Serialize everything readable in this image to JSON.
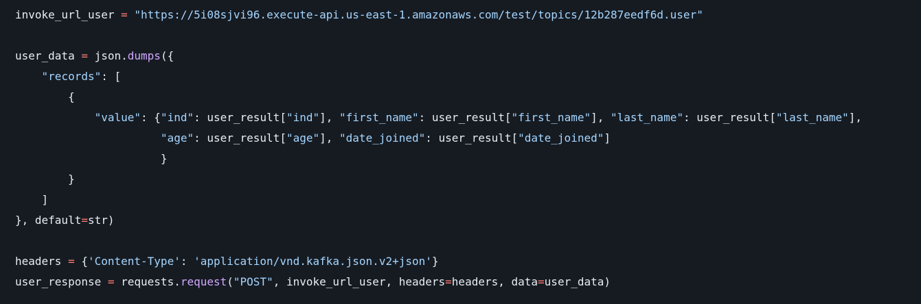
{
  "lines": [
    [
      {
        "t": "invoke_url_user ",
        "c": "plain"
      },
      {
        "t": "=",
        "c": "op"
      },
      {
        "t": " ",
        "c": "plain"
      },
      {
        "t": "\"https://5i08sjvi96.execute-api.us-east-1.amazonaws.com/test/topics/12b287eedf6d.user\"",
        "c": "string"
      }
    ],
    [],
    [
      {
        "t": "user_data ",
        "c": "plain"
      },
      {
        "t": "=",
        "c": "op"
      },
      {
        "t": " json.",
        "c": "plain"
      },
      {
        "t": "dumps",
        "c": "func"
      },
      {
        "t": "({",
        "c": "plain"
      }
    ],
    [
      {
        "t": "    ",
        "c": "plain"
      },
      {
        "t": "\"records\"",
        "c": "string"
      },
      {
        "t": ": [",
        "c": "plain"
      }
    ],
    [
      {
        "t": "        {",
        "c": "plain"
      }
    ],
    [
      {
        "t": "            ",
        "c": "plain"
      },
      {
        "t": "\"value\"",
        "c": "string"
      },
      {
        "t": ": {",
        "c": "plain"
      },
      {
        "t": "\"ind\"",
        "c": "string"
      },
      {
        "t": ": user_result[",
        "c": "plain"
      },
      {
        "t": "\"ind\"",
        "c": "string"
      },
      {
        "t": "], ",
        "c": "plain"
      },
      {
        "t": "\"first_name\"",
        "c": "string"
      },
      {
        "t": ": user_result[",
        "c": "plain"
      },
      {
        "t": "\"first_name\"",
        "c": "string"
      },
      {
        "t": "], ",
        "c": "plain"
      },
      {
        "t": "\"last_name\"",
        "c": "string"
      },
      {
        "t": ": user_result[",
        "c": "plain"
      },
      {
        "t": "\"last_name\"",
        "c": "string"
      },
      {
        "t": "],",
        "c": "plain"
      }
    ],
    [
      {
        "t": "                      ",
        "c": "plain"
      },
      {
        "t": "\"age\"",
        "c": "string"
      },
      {
        "t": ": user_result[",
        "c": "plain"
      },
      {
        "t": "\"age\"",
        "c": "string"
      },
      {
        "t": "], ",
        "c": "plain"
      },
      {
        "t": "\"date_joined\"",
        "c": "string"
      },
      {
        "t": ": user_result[",
        "c": "plain"
      },
      {
        "t": "\"date_joined\"",
        "c": "string"
      },
      {
        "t": "]",
        "c": "plain"
      }
    ],
    [
      {
        "t": "                      }",
        "c": "plain"
      }
    ],
    [
      {
        "t": "        }",
        "c": "plain"
      }
    ],
    [
      {
        "t": "    ]",
        "c": "plain"
      }
    ],
    [
      {
        "t": "}, default",
        "c": "plain"
      },
      {
        "t": "=",
        "c": "op"
      },
      {
        "t": "str)",
        "c": "plain"
      }
    ],
    [],
    [
      {
        "t": "headers ",
        "c": "plain"
      },
      {
        "t": "=",
        "c": "op"
      },
      {
        "t": " {",
        "c": "plain"
      },
      {
        "t": "'Content-Type'",
        "c": "string"
      },
      {
        "t": ": ",
        "c": "plain"
      },
      {
        "t": "'application/vnd.kafka.json.v2+json'",
        "c": "string"
      },
      {
        "t": "}",
        "c": "plain"
      }
    ],
    [
      {
        "t": "user_response ",
        "c": "plain"
      },
      {
        "t": "=",
        "c": "op"
      },
      {
        "t": " requests.",
        "c": "plain"
      },
      {
        "t": "request",
        "c": "func"
      },
      {
        "t": "(",
        "c": "plain"
      },
      {
        "t": "\"POST\"",
        "c": "string"
      },
      {
        "t": ", invoke_url_user, headers",
        "c": "plain"
      },
      {
        "t": "=",
        "c": "op"
      },
      {
        "t": "headers, data",
        "c": "plain"
      },
      {
        "t": "=",
        "c": "op"
      },
      {
        "t": "user_data)",
        "c": "plain"
      }
    ]
  ],
  "colors": {
    "background": "#161b22",
    "plain": "#e6edf3",
    "string": "#a5d6ff",
    "func": "#d2a8ff",
    "op": "#ff7b72"
  }
}
